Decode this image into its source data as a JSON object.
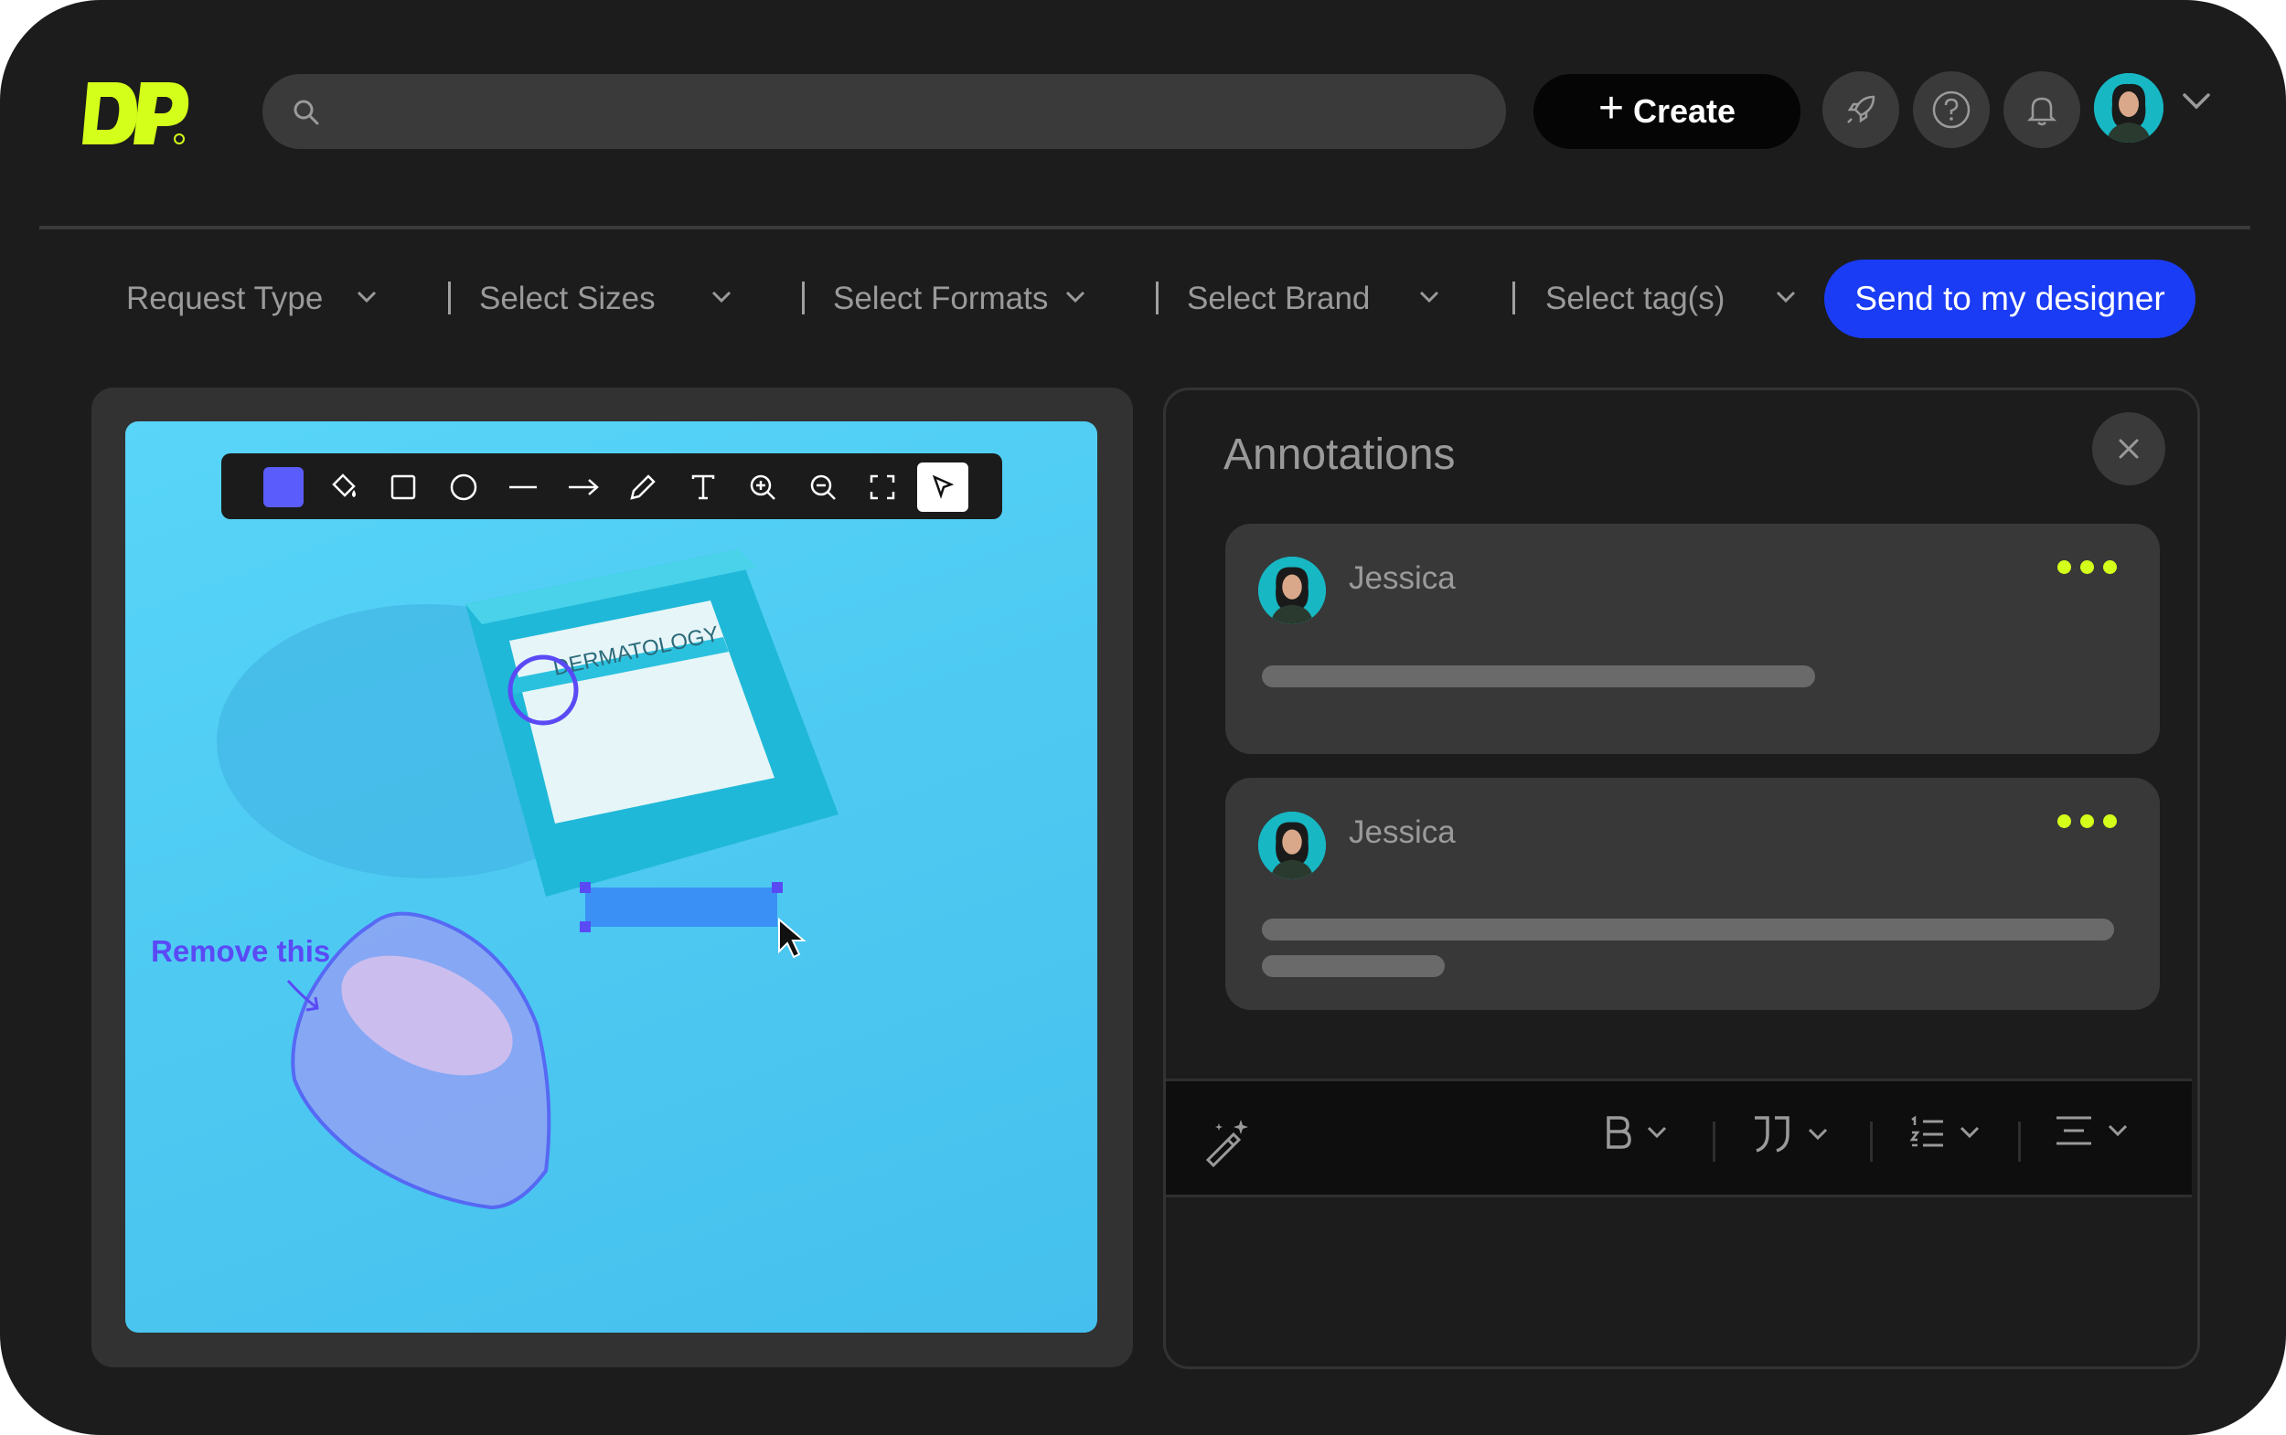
{
  "header": {
    "logo_text": "DP",
    "create_label": "Create",
    "create_plus": "+"
  },
  "filters": {
    "request_type": "Request Type",
    "select_sizes": "Select Sizes",
    "select_formats": "Select Formats",
    "select_brand": "Select Brand",
    "select_tags": "Select tag(s)",
    "send_label": "Send to my designer"
  },
  "canvas": {
    "tools": [
      "color-swatch",
      "fill",
      "rectangle",
      "ellipse",
      "line",
      "arrow",
      "pencil",
      "text",
      "zoom-in",
      "zoom-out",
      "fit-screen",
      "select"
    ],
    "active_tool": "select",
    "active_color": "#5a5cfb",
    "annotation_text": "Remove this",
    "product_box_text": "DERMATOLOGY"
  },
  "annotations": {
    "title": "Annotations",
    "cards": [
      {
        "author": "Jessica"
      },
      {
        "author": "Jessica"
      }
    ]
  },
  "editor_toolbar": {
    "tools": [
      "magic-wand",
      "bold",
      "quote",
      "list",
      "align"
    ]
  },
  "colors": {
    "background": "#1c1c1c",
    "accent_blue": "#1a3cf5",
    "accent_lime": "#d4ff1a",
    "canvas_bg": "#4cc8f1"
  }
}
